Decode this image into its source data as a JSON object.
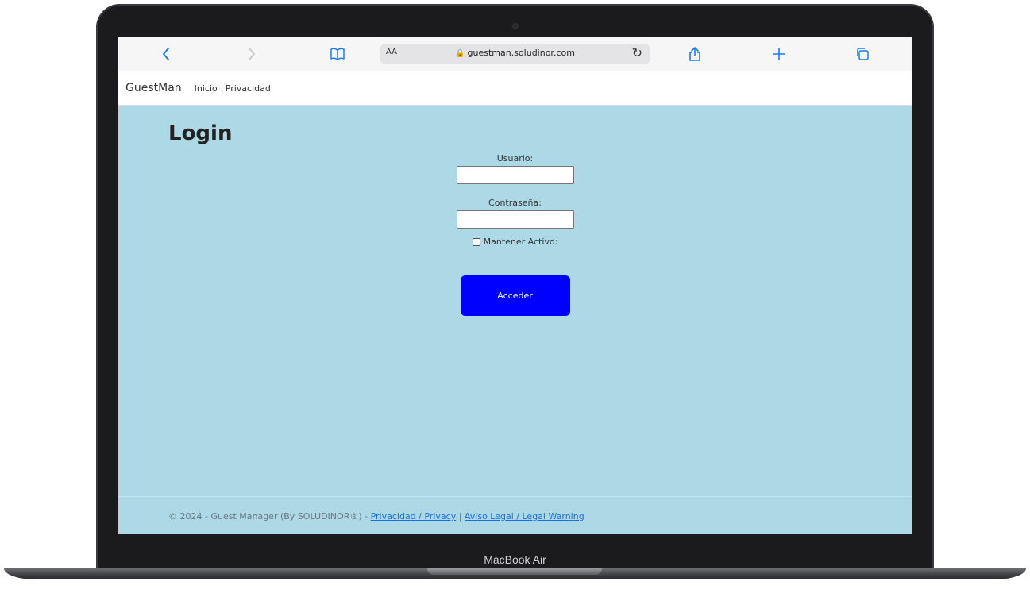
{
  "device": {
    "label": "MacBook Air"
  },
  "browser": {
    "reader_icon": "book-icon",
    "text_size_label": "AA",
    "url": "guestman.soludinor.com",
    "back_icon": "<",
    "forward_icon": ">",
    "share_icon": "share-icon",
    "new_tab_icon": "+",
    "tabs_icon": "tabs-icon"
  },
  "navbar": {
    "brand": "GuestMan",
    "links": [
      "Inicio",
      "Privacidad"
    ]
  },
  "login": {
    "title": "Login",
    "user_label": "Usuario:",
    "user_value": "",
    "password_label": "Contraseña:",
    "password_value": "",
    "remember_label": "Mantener Activo:",
    "remember_checked": false,
    "submit_label": "Acceder"
  },
  "footer": {
    "copyright": "© 2024 - Guest Manager (By SOLUDINOR®) - ",
    "privacy_link": "Privacidad / Privacy",
    "separator": " | ",
    "legal_link": "Aviso Legal / Legal Warning"
  },
  "colors": {
    "page_background": "#add8e6",
    "submit_button": "#0000ff",
    "browser_accent": "#1a7cf5"
  }
}
